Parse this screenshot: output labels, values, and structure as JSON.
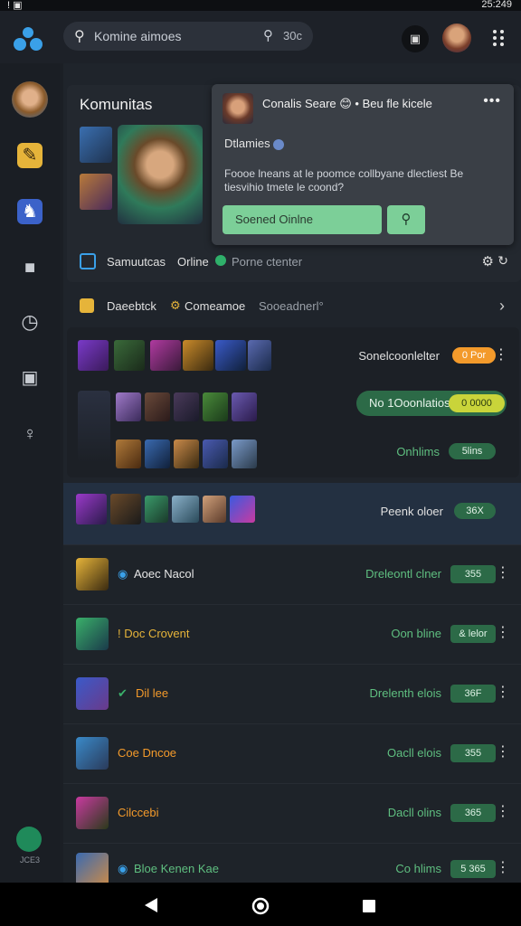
{
  "status_bar": {
    "left": "! ▣",
    "time": "25:249"
  },
  "search": {
    "placeholder": "Komine aimoes",
    "badge": "30c"
  },
  "community_card": {
    "title": "Komunitas"
  },
  "popup": {
    "name": "Conalis Seare 😊 • Beu fle kicele",
    "subtitle": "Dtlamies",
    "description": "Foooe lneans at le poomce collbyane dlectiest Be tiesvihio tmete le coond?",
    "primary_button": "Soened Oinlne"
  },
  "community_row": {
    "label1": "Samuutcas",
    "label2": "Orline",
    "label3": "Porne ctenter"
  },
  "section_header": {
    "label1": "Daeebtck",
    "label2": "Comeamoe",
    "label3": "Sooeadnerl°"
  },
  "group": {
    "rows": [
      {
        "status": "Sonelcoonlelter",
        "badge": "0 Por"
      },
      {
        "status": "No 1Ooonlatios",
        "badge": "0 0000"
      },
      {
        "status": "Onhlims",
        "badge": "5lins"
      }
    ]
  },
  "highlight_row": {
    "status": "Peenk oloer",
    "badge": "36X"
  },
  "list": [
    {
      "name": "Aoec Nacol",
      "status": "Dreleontl clner",
      "badge": "355"
    },
    {
      "name": "! Doc Crovent",
      "status": "Oon bline",
      "badge": "& lelor"
    },
    {
      "name": "Dil lee",
      "status": "Drelenth elois",
      "badge": "36F"
    },
    {
      "name": "Coe Dncoe",
      "status": "Oacll elois",
      "badge": "355"
    },
    {
      "name": "Cilccebi",
      "status": "Dacll olins",
      "badge": "365"
    },
    {
      "name": "Bloe Kenen Kae",
      "status": "Co hlims",
      "badge": "5 365"
    }
  ],
  "sidebar": {
    "version": "JCE3"
  },
  "colors": {
    "accent_green": "#5fbf80",
    "orange": "#f39a2b",
    "primary_button": "#7ccf98"
  }
}
